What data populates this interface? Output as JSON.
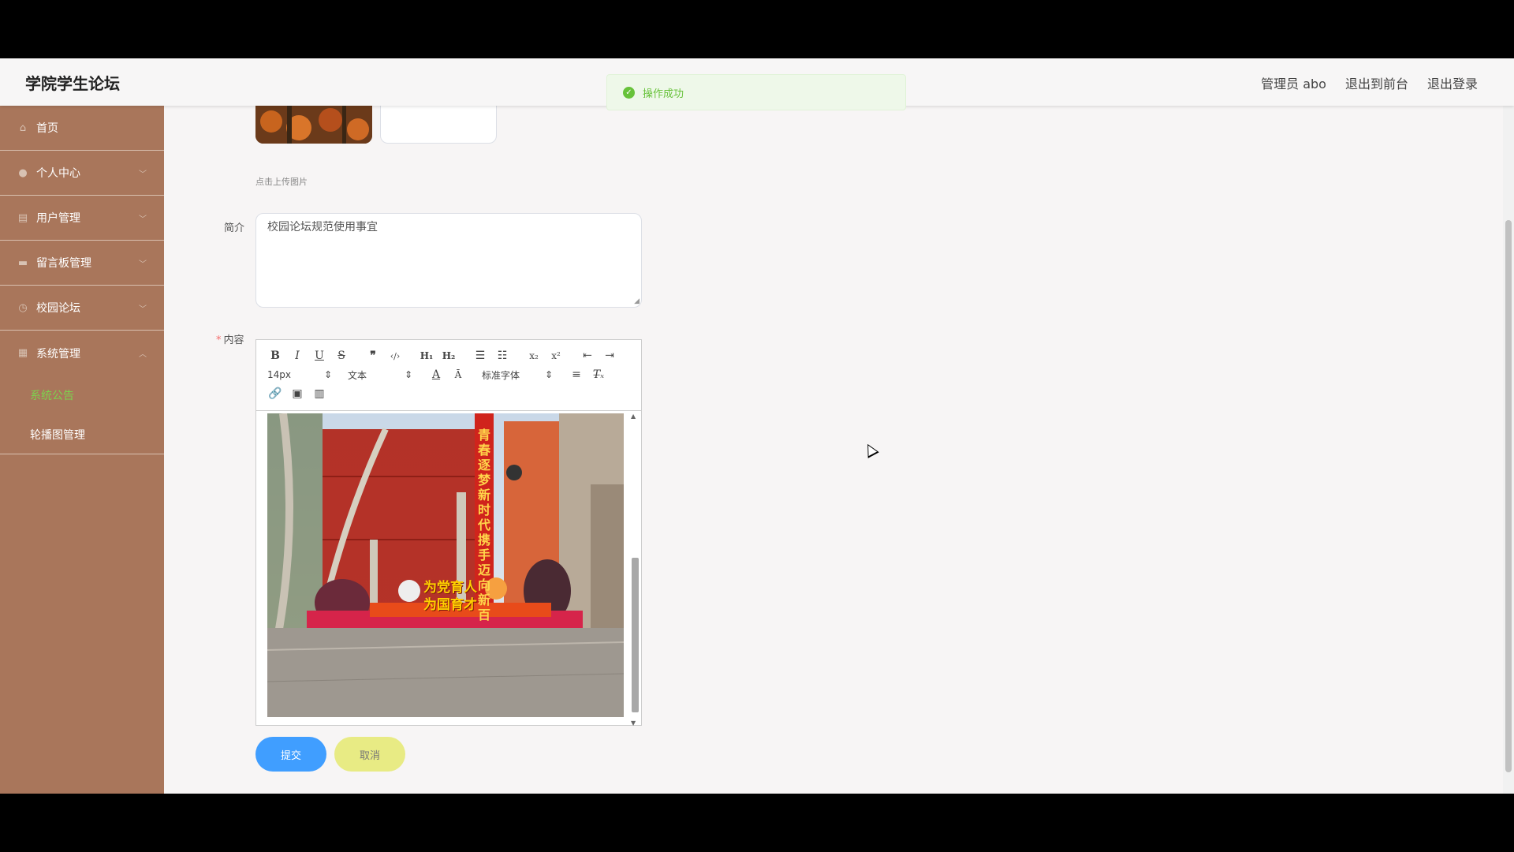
{
  "header": {
    "title": "学院学生论坛",
    "links": [
      "管理员 abo",
      "退出到前台",
      "退出登录"
    ]
  },
  "toast": {
    "message": "操作成功",
    "type": "success"
  },
  "sidebar": {
    "items": [
      {
        "label": "首页",
        "icon": "home-icon",
        "arrow": ""
      },
      {
        "label": "个人中心",
        "icon": "user-icon",
        "arrow": "﹀"
      },
      {
        "label": "用户管理",
        "icon": "clipboard-icon",
        "arrow": "﹀"
      },
      {
        "label": "留言板管理",
        "icon": "message-icon",
        "arrow": "﹀"
      },
      {
        "label": "校园论坛",
        "icon": "clock-icon",
        "arrow": "﹀"
      },
      {
        "label": "系统管理",
        "icon": "grid-icon",
        "arrow": "︿"
      }
    ],
    "subitems": [
      {
        "label": "系统公告",
        "active": true
      },
      {
        "label": "轮播图管理",
        "active": false
      }
    ]
  },
  "form": {
    "upload_hint": "点击上传图片",
    "intro_label": "简介",
    "intro_value": "校园论坛规范使用事宜",
    "content_label": "内容",
    "required_mark": "*",
    "font_size": "14px",
    "text_style": "文本",
    "font_family": "标准字体",
    "submit_label": "提交",
    "cancel_label": "取消"
  },
  "editor_image": {
    "banner_vertical": "青春逐梦新时代 携手迈向新百",
    "slogan_line1": "为党育人",
    "slogan_line2": "为国育才"
  },
  "colors": {
    "sidebar_bg": "#a9765b",
    "active_sub": "#7cd34e",
    "submit_btn": "#409eff",
    "cancel_btn": "#e8eb84",
    "toast_text": "#67c23a"
  }
}
